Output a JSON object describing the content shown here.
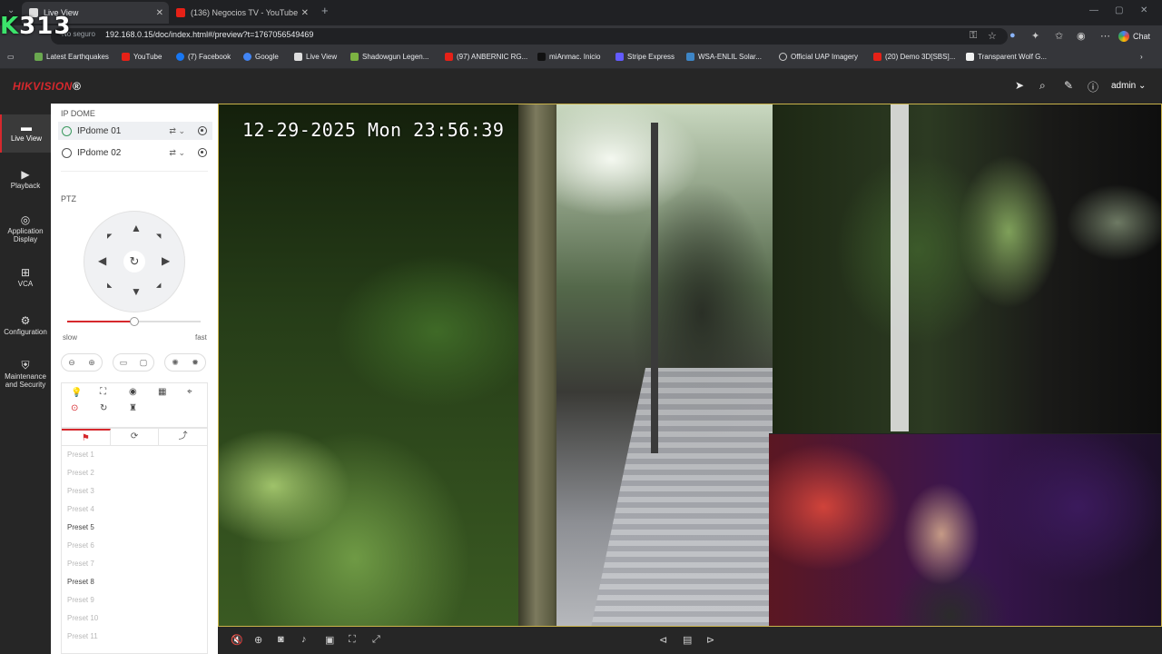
{
  "browser": {
    "tabs": [
      {
        "label": "Live View",
        "active": true
      },
      {
        "label": "(136) Negocios TV - YouTube",
        "active": false
      }
    ],
    "url_prefix": "No seguro",
    "url": "192.168.0.15/doc/index.html#/preview?t=1767056549469",
    "chat_label": "Chat",
    "bookmarks": [
      "Latest Earthquakes",
      "YouTube",
      "(7) Facebook",
      "Google",
      "Live View",
      "Shadowgun Legen...",
      "(97) ANBERNIC RG...",
      "miAnmac. Inicio",
      "Stripe Express",
      "WSA-ENLIL Solar...",
      "Official UAP Imagery",
      "(20) Demo 3D[SBS]...",
      "Transparent Wolf G..."
    ]
  },
  "overlay": {
    "k": "K",
    "number": "313"
  },
  "app": {
    "logo_main": "HIKVISION",
    "logo_mark": "®",
    "user": "admin",
    "nav": [
      {
        "label": "Live View",
        "icon": "monitor-icon",
        "active": true
      },
      {
        "label": "Playback",
        "icon": "playback-icon",
        "active": false
      },
      {
        "label": "Application Display",
        "icon": "application-icon",
        "active": false
      },
      {
        "label": "VCA",
        "icon": "vca-icon",
        "active": false
      },
      {
        "label": "Configuration",
        "icon": "gear-icon",
        "active": false
      },
      {
        "label": "Maintenance and Security",
        "icon": "maintenance-icon",
        "active": false
      }
    ]
  },
  "panel": {
    "group_title": "IP DOME",
    "cameras": [
      {
        "name": "IPdome 01",
        "selected": true
      },
      {
        "name": "IPdome 02",
        "selected": false
      }
    ],
    "ptz_title": "PTZ",
    "speed": {
      "slow_label": "slow",
      "fast_label": "fast",
      "value": 0.5
    },
    "preset_tabs": [
      "preset-tab",
      "patrol-tab",
      "pattern-tab"
    ],
    "presets": [
      {
        "label": "Preset 1",
        "set": false
      },
      {
        "label": "Preset 2",
        "set": false
      },
      {
        "label": "Preset 3",
        "set": false
      },
      {
        "label": "Preset 4",
        "set": false
      },
      {
        "label": "Preset 5",
        "set": true
      },
      {
        "label": "Preset 6",
        "set": false
      },
      {
        "label": "Preset 7",
        "set": false
      },
      {
        "label": "Preset 8",
        "set": true
      },
      {
        "label": "Preset 9",
        "set": false
      },
      {
        "label": "Preset 10",
        "set": false
      },
      {
        "label": "Preset 11",
        "set": false
      }
    ]
  },
  "video": {
    "timestamp": "12-29-2025 Mon 23:56:39",
    "accent_color": "#c9b24a"
  },
  "colors": {
    "brand": "#d6282d",
    "header_bg": "#262626"
  }
}
